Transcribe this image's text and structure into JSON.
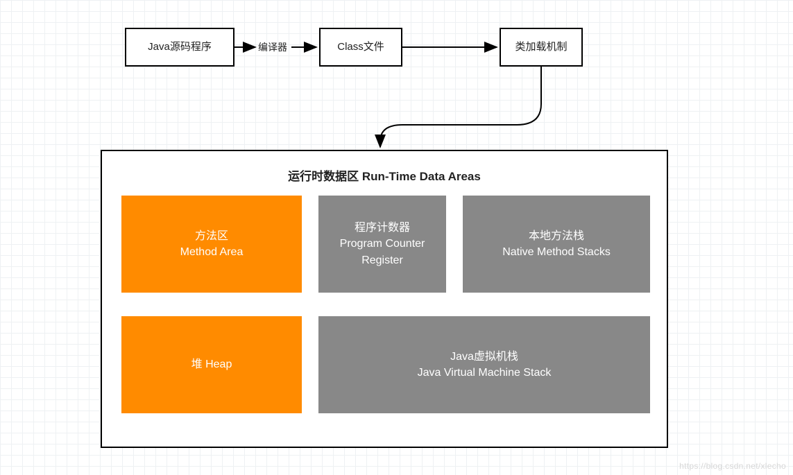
{
  "top_flow": {
    "source_box": "Java源码程序",
    "compiler_label": "编译器",
    "class_box": "Class文件",
    "loader_box": "类加载机制"
  },
  "runtime_area": {
    "title": "运行时数据区 Run-Time Data Areas",
    "method_area_cn": "方法区",
    "method_area_en": "Method Area",
    "pc_cn": "程序计数器",
    "pc_en1": "Program Counter",
    "pc_en2": "Register",
    "native_cn": "本地方法栈",
    "native_en": "Native Method Stacks",
    "heap": "堆 Heap",
    "jvm_stack_cn": "Java虚拟机栈",
    "jvm_stack_en": "Java Virtual Machine Stack"
  },
  "watermark": "https://blog.csdn.net/xlecho",
  "chart_data": {
    "type": "flow-diagram",
    "nodes": [
      {
        "id": "src",
        "label": "Java源码程序"
      },
      {
        "id": "class",
        "label": "Class文件"
      },
      {
        "id": "loader",
        "label": "类加载机制"
      },
      {
        "id": "runtime",
        "label": "运行时数据区 Run-Time Data Areas",
        "children": [
          {
            "id": "method_area",
            "label_cn": "方法区",
            "label_en": "Method Area",
            "color": "orange"
          },
          {
            "id": "pc_register",
            "label_cn": "程序计数器",
            "label_en": "Program Counter Register",
            "color": "gray"
          },
          {
            "id": "native_stack",
            "label_cn": "本地方法栈",
            "label_en": "Native Method Stacks",
            "color": "gray"
          },
          {
            "id": "heap",
            "label_cn": "堆",
            "label_en": "Heap",
            "color": "orange"
          },
          {
            "id": "jvm_stack",
            "label_cn": "Java虚拟机栈",
            "label_en": "Java Virtual Machine Stack",
            "color": "gray"
          }
        ]
      }
    ],
    "edges": [
      {
        "from": "src",
        "to": "class",
        "label": "编译器"
      },
      {
        "from": "class",
        "to": "loader",
        "label": ""
      },
      {
        "from": "loader",
        "to": "runtime",
        "label": ""
      }
    ]
  }
}
